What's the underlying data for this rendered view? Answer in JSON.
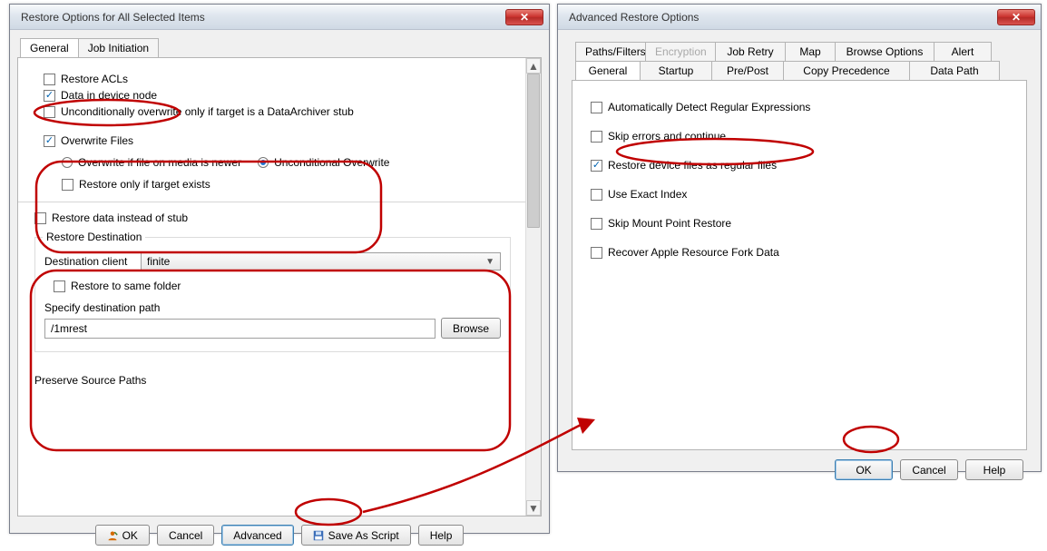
{
  "dlg1": {
    "title": "Restore Options for All Selected Items",
    "tabs": {
      "general": "General",
      "jobinit": "Job Initiation"
    },
    "chk_restore_acls": "Restore ACLs",
    "chk_data_device_node": "Data in device node",
    "chk_uncond_overwrite_stub": "Unconditionally overwrite only if target is a DataArchiver stub",
    "chk_overwrite_files": "Overwrite Files",
    "rad_overwrite_newer": "Overwrite if file on media is newer",
    "rad_uncond_overwrite": "Unconditional Overwrite",
    "chk_restore_only_if_target_exists": "Restore only if target exists",
    "chk_restore_data_instead_stub": "Restore data instead of stub",
    "grp_restore_dest": "Restore Destination",
    "lbl_dest_client": "Destination client",
    "dest_client_value": "finite",
    "chk_restore_same_folder": "Restore to same folder",
    "lbl_specify_dest_path": "Specify destination path",
    "dest_path_value": "/1mrest",
    "btn_browse": "Browse",
    "lbl_preserve_source_paths": "Preserve Source Paths",
    "buttons": {
      "ok": "OK",
      "cancel": "Cancel",
      "advanced": "Advanced",
      "savescript": "Save As Script",
      "help": "Help"
    }
  },
  "dlg2": {
    "title": "Advanced Restore Options",
    "tabs_row1": {
      "paths": "Paths/Filters",
      "encryption": "Encryption",
      "jobretry": "Job Retry",
      "map": "Map",
      "browseopts": "Browse Options",
      "alert": "Alert"
    },
    "tabs_row2": {
      "general": "General",
      "startup": "Startup",
      "prepost": "Pre/Post",
      "copyprec": "Copy Precedence",
      "datapath": "Data Path"
    },
    "chk_auto_detect_regex": "Automatically Detect Regular Expressions",
    "chk_skip_errors": "Skip errors and continue",
    "chk_restore_device_files": "Restore device files as regular files",
    "chk_use_exact_index": "Use Exact Index",
    "chk_skip_mount_point": "Skip Mount Point Restore",
    "chk_recover_apple_fork": "Recover Apple Resource Fork Data",
    "buttons": {
      "ok": "OK",
      "cancel": "Cancel",
      "help": "Help"
    }
  }
}
